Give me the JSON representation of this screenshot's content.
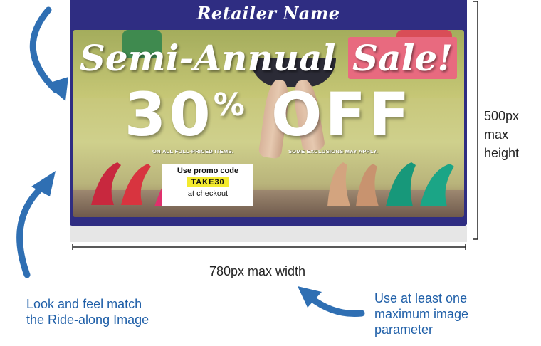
{
  "banner": {
    "retailer_name": "Retailer Name",
    "title_part1": "Semi-Annual",
    "title_part2": "Sale!",
    "offer_number": "30",
    "offer_percent": "%",
    "offer_word": "OFF",
    "fine_left": "ON ALL FULL-PRICED ITEMS.",
    "fine_right": "SOME EXCLUSIONS MAY APPLY.",
    "promo": {
      "line1": "Use promo code",
      "code": "TAKE30",
      "line3": "at checkout"
    }
  },
  "dimensions": {
    "width_label": "780px max width",
    "height_label_1": "500px",
    "height_label_2": "max",
    "height_label_3": "height"
  },
  "notes": {
    "left_line1": "Look and feel match",
    "left_line2": "the Ride-along Image",
    "right_line1": "Use at least one",
    "right_line2": "maximum image",
    "right_line3": "parameter"
  },
  "colors": {
    "banner_navy": "#2f2d82",
    "sale_pink": "#e86a7f",
    "promo_yellow": "#f3ea2e",
    "note_blue": "#1f5fa8",
    "arrow_blue": "#2f6fb3"
  }
}
